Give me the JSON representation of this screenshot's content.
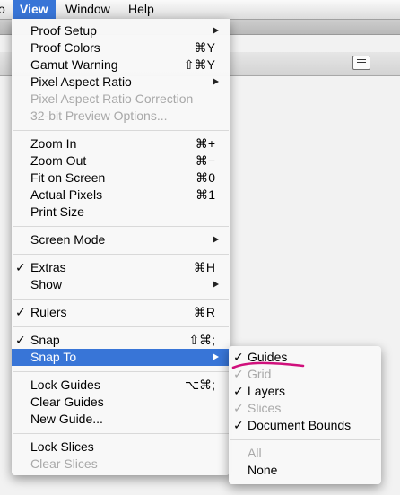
{
  "menubar": {
    "partial_left": "o",
    "view": "View",
    "window": "Window",
    "help": "Help"
  },
  "menu": {
    "proof_setup": "Proof Setup",
    "proof_colors": "Proof Colors",
    "proof_colors_sc": "⌘Y",
    "gamut_warning": "Gamut Warning",
    "gamut_warning_sc": "⇧⌘Y",
    "pixel_aspect_ratio": "Pixel Aspect Ratio",
    "pixel_aspect_ratio_correction": "Pixel Aspect Ratio Correction",
    "preview_options": "32-bit Preview Options...",
    "zoom_in": "Zoom In",
    "zoom_in_sc": "⌘+",
    "zoom_out": "Zoom Out",
    "zoom_out_sc": "⌘−",
    "fit_on_screen": "Fit on Screen",
    "fit_on_screen_sc": "⌘0",
    "actual_pixels": "Actual Pixels",
    "actual_pixels_sc": "⌘1",
    "print_size": "Print Size",
    "screen_mode": "Screen Mode",
    "extras": "Extras",
    "extras_sc": "⌘H",
    "show": "Show",
    "rulers": "Rulers",
    "rulers_sc": "⌘R",
    "snap": "Snap",
    "snap_sc": "⇧⌘;",
    "snap_to": "Snap To",
    "lock_guides": "Lock Guides",
    "lock_guides_sc": "⌥⌘;",
    "clear_guides": "Clear Guides",
    "new_guide": "New Guide...",
    "lock_slices": "Lock Slices",
    "clear_slices": "Clear Slices"
  },
  "submenu": {
    "guides": "Guides",
    "grid": "Grid",
    "layers": "Layers",
    "slices": "Slices",
    "document_bounds": "Document Bounds",
    "all": "All",
    "none": "None"
  },
  "glyphs": {
    "check": "✓"
  },
  "colors": {
    "highlight": "#3875d7",
    "annotation": "#d0107c"
  }
}
